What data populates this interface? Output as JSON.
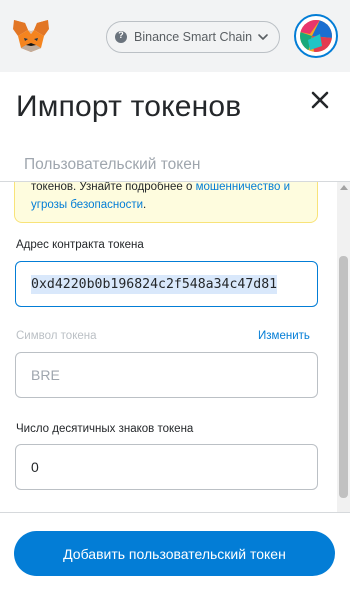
{
  "header": {
    "network_label": "Binance Smart Chain",
    "icons": [
      "metamask-fox-icon",
      "network-status-icon",
      "chevron-down-icon",
      "account-avatar"
    ]
  },
  "page": {
    "title": "Импорт токенов",
    "close_icon": "close-icon"
  },
  "tabs": [
    {
      "label": "Пользовательский токен"
    }
  ],
  "warning": {
    "text": "токенов. Узнайте подробнее о ",
    "link": "мошенничество и угрозы безопасности",
    "suffix": "."
  },
  "form": {
    "address_label": "Адрес контракта токена",
    "address_value": "0xd4220b0b196824c2f548a34c47d81",
    "symbol_label": "Символ токена",
    "symbol_edit": "Изменить",
    "symbol_value": "BRE",
    "decimals_label": "Число десятичных знаков токена",
    "decimals_value": "0"
  },
  "footer": {
    "add_button_label": "Добавить пользовательский токен"
  },
  "colors": {
    "accent": "#037dd6",
    "warning_bg": "#fefcde",
    "warning_border": "#f8e379",
    "header_bg": "#f2f3f4"
  }
}
